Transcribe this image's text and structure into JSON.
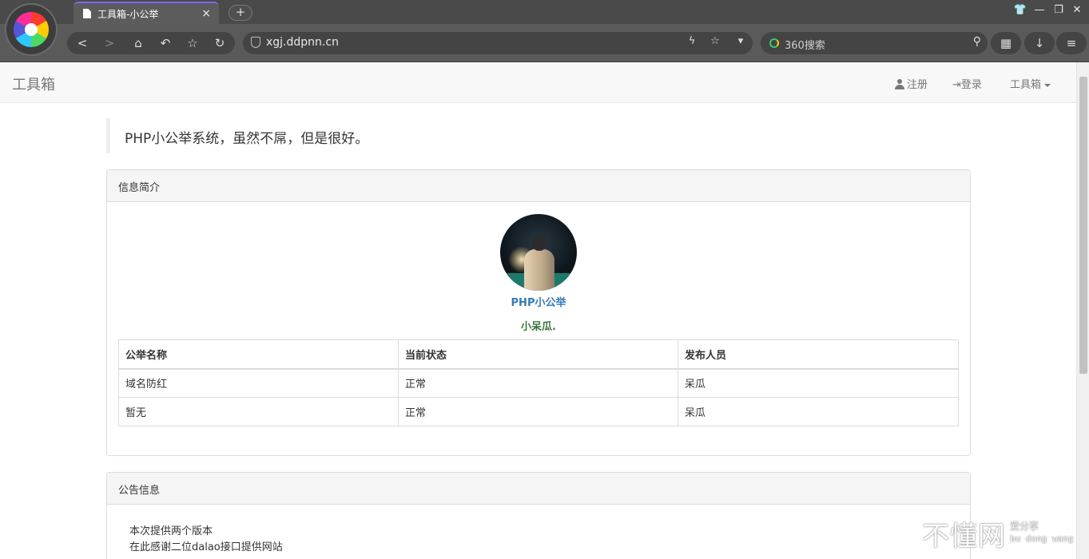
{
  "browser": {
    "tab_title": "工具箱-小公举",
    "tab_close": "×",
    "new_tab": "+",
    "url": "xgj.ddpnn.cn",
    "search_placeholder": "360搜索",
    "nav": {
      "back": "<",
      "forward": ">",
      "home": "⌂",
      "undo": "↶",
      "star": "☆",
      "refresh": "↻"
    },
    "addr_icons": {
      "bolt": "ϟ",
      "star": "☆",
      "dropdown": "▾"
    },
    "search_icon": "⚲",
    "window": {
      "skin": "👕",
      "minimize": "—",
      "restore": "❐",
      "close": "✕"
    },
    "toolbar": {
      "apps": "▦",
      "download": "↓",
      "menu": "≡"
    }
  },
  "navbar": {
    "brand": "工具箱",
    "register": "注册",
    "login": "登录",
    "tools": "工具箱",
    "login_icon": "⇥"
  },
  "quote": "PHP小公举系统，虽然不屌，但是很好。",
  "info_panel": {
    "title": "信息简介",
    "profile_name": "PHP小公举",
    "nickname": "小呆瓜.",
    "table": {
      "headers": [
        "公举名称",
        "当前状态",
        "发布人员"
      ],
      "rows": [
        [
          "域名防红",
          "正常",
          "呆瓜"
        ],
        [
          "暂无",
          "正常",
          "呆瓜"
        ]
      ]
    }
  },
  "notice_panel": {
    "title": "公告信息",
    "lines": [
      "本次提供两个版本",
      "在此感谢二位dalao接口提供网站"
    ]
  },
  "watermark": {
    "main": "不懂网",
    "sub": "爱分享",
    "pinyin": "bu dong wang"
  }
}
